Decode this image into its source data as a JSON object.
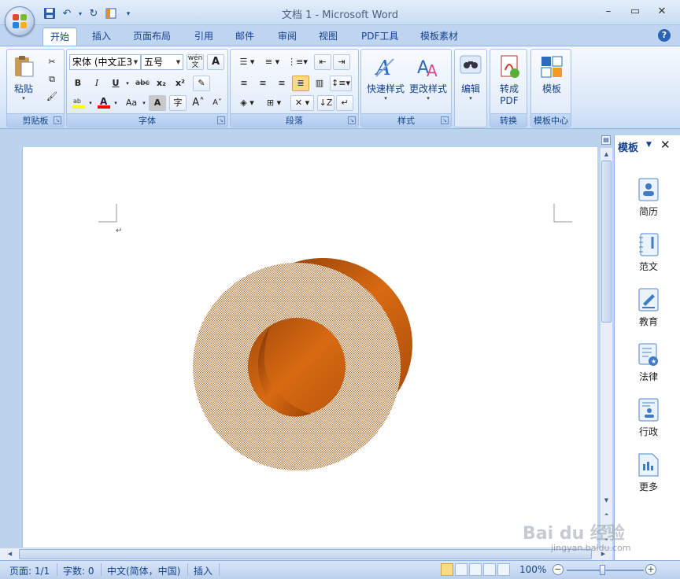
{
  "window": {
    "title": "文档 1 - Microsoft Word"
  },
  "qat": {
    "save": "save-icon",
    "undo": "undo-icon",
    "redo": "redo-icon",
    "customize": "▾"
  },
  "tabs": [
    "开始",
    "插入",
    "页面布局",
    "引用",
    "邮件",
    "审阅",
    "视图",
    "PDF工具",
    "模板素材"
  ],
  "active_tab": "开始",
  "ribbon": {
    "clipboard": {
      "label": "剪贴板",
      "paste": "粘贴"
    },
    "font": {
      "label": "字体",
      "font_name": "宋体 (中文正3",
      "font_size": "五号",
      "bold": "B",
      "italic": "I",
      "underline": "U",
      "strike": "abc",
      "subscript": "x₂",
      "superscript": "x²",
      "change_case": "Aa",
      "char_shading": "A",
      "enclosed": "字",
      "grow": "A",
      "shrink": "A",
      "phonetic": "wén",
      "border": "A"
    },
    "paragraph": {
      "label": "段落"
    },
    "styles": {
      "label": "样式",
      "quick_styles": "快速样式",
      "change_styles": "更改样式"
    },
    "editing": {
      "edit": "编辑"
    },
    "convert": {
      "label": "转换",
      "to_pdf_1": "转成",
      "to_pdf_2": "PDF"
    },
    "template": {
      "label": "模板中心",
      "template": "模板"
    }
  },
  "pane": {
    "title": "模板",
    "items": [
      "简历",
      "范文",
      "教育",
      "法律",
      "行政",
      "更多"
    ]
  },
  "status": {
    "page": "页面: 1/1",
    "words": "字数: 0",
    "language": "中文(简体，中国)",
    "mode": "插入",
    "zoom": "100%",
    "zoom_minus": "−",
    "zoom_plus": "+"
  },
  "watermark": {
    "text": "Bai du 经验",
    "url": "jingyan.baidu.com"
  },
  "colors": {
    "ring_shade": "#c55a0b",
    "ring_face": "#c9a070",
    "accent": "#15428b"
  }
}
